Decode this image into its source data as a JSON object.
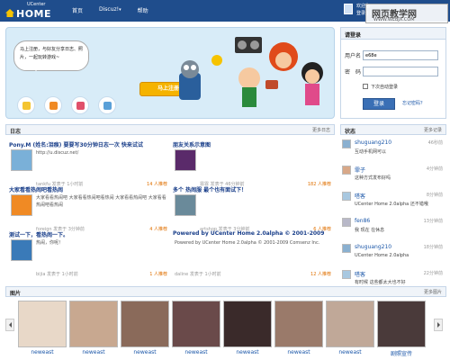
{
  "header": {
    "logo_small": "UCenter",
    "logo_big": "HOME",
    "nav": [
      "首页",
      "Discuz!",
      "帮助"
    ],
    "nav_dropdown": "▾",
    "user_line1": "欢迎您",
    "user_line2": "登录 | 注册",
    "watermark_title": "网页教学网",
    "watermark_url": "WWW.WEBJX.COM"
  },
  "banner": {
    "bubble_text": "马上注册，与好友分享日志、照片，一起玩转游戏~",
    "register_button": "马上注册"
  },
  "login": {
    "title": "请登录",
    "username_label": "用户名",
    "username_value": "e68e",
    "password_label": "密　码",
    "password_value": "",
    "remember_label": "下次自动登录",
    "login_button": "登录",
    "forgot_link": "忘记密码？"
  },
  "blog": {
    "title": "日志",
    "more": "更多日志",
    "posts": [
      {
        "title": "Pony.M (姓名:泪痕) 要要写30分钟日志一次 快来试试",
        "body": "http://u.discuz.net/",
        "meta": "tankfu 发表于 1小时前",
        "rec": "14 人推荐"
      },
      {
        "title": "朋友关系示意图",
        "body": "",
        "meta": "霏霏 发表于 46分钟前",
        "rec": "182 人推荐"
      },
      {
        "title": "大家看看热闹吧看热闹",
        "body": "大家看看热闹吧 大家看看热闹吧看热闹 大家看看热闹吧 大家看看热闹吧看热闹",
        "meta": "foreign 发表于 3分钟前",
        "rec": "4 人推荐"
      },
      {
        "title": "多个 热闹服 最个也有面试下！",
        "body": "",
        "meta": "artshop 发表于 3分钟前",
        "rec": "6 人推荐"
      },
      {
        "title": "测试一下，看热闹一下。",
        "body": "热闹，你呢！",
        "meta": "bijia 发表于 1小时前",
        "rec": "1 人推荐"
      },
      {
        "title": "Powered by UCenter Home 2.0alpha © 2001-2009",
        "body": "Powered by UCenter Home 2.0alpha © 2001-2009 Comsenz Inc.",
        "meta": "daline 发表于 1小时前",
        "rec": "12 人推荐"
      }
    ]
  },
  "status": {
    "title": "状态",
    "more": "更多记录",
    "items": [
      {
        "name": "shuguang210",
        "time": "46秒前",
        "text": "互动手机网可以"
      },
      {
        "name": "霏子",
        "time": "4分钟前",
        "text": "这种方式发布好吗"
      },
      {
        "name": "嗒客",
        "time": "8分钟前",
        "text": "UCenter Home 2.0alpha 还不错哦"
      },
      {
        "name": "fen86",
        "time": "13分钟前",
        "text": "我 现在 在休息"
      },
      {
        "name": "shuguang210",
        "time": "18分钟前",
        "text": "UCenter Home 2.0alpha"
      },
      {
        "name": "嗒客",
        "time": "22分钟前",
        "text": "有时候 这些都太大也不好"
      }
    ]
  },
  "photos": {
    "title": "图片",
    "more": "更多图片",
    "items": [
      {
        "caption": "neweast",
        "color": "#e8d8c8"
      },
      {
        "caption": "neweast",
        "color": "#c8a890"
      },
      {
        "caption": "neweast",
        "color": "#8a6a5a"
      },
      {
        "caption": "neweast",
        "color": "#6a4a4a"
      },
      {
        "caption": "neweast",
        "color": "#3a2a2a"
      },
      {
        "caption": "neweast",
        "color": "#9a7a6a"
      },
      {
        "caption": "neweast",
        "color": "#c0a898"
      },
      {
        "caption": "剧照宣传",
        "color": "#4a3a3a"
      }
    ]
  }
}
